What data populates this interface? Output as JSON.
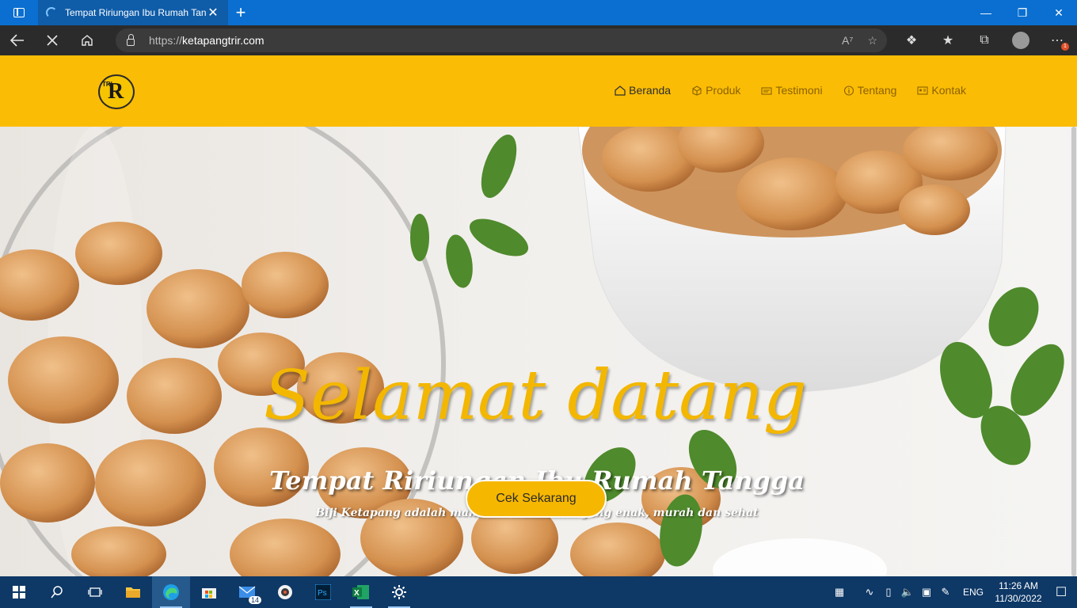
{
  "browser": {
    "tab_title": "Tempat Ririungan Ibu Rumah Tan",
    "tab_close": "✕",
    "new_tab": "+",
    "url_prefix": "https://",
    "url_domain": "ketapangtrir.com",
    "badge_count": "1"
  },
  "site": {
    "logo_text": "R",
    "logo_small": "TRI",
    "nav": [
      {
        "label": "Beranda",
        "icon": "home-icon"
      },
      {
        "label": "Produk",
        "icon": "box-icon"
      },
      {
        "label": "Testimoni",
        "icon": "card-icon"
      },
      {
        "label": "Tentang",
        "icon": "info-icon"
      },
      {
        "label": "Kontak",
        "icon": "contact-icon"
      }
    ],
    "hero": {
      "title": "Selamat datang",
      "subtitle": "Tempat Ririungan Ibu Rumah Tangga",
      "tagline": "Biji Ketapang adalah makanan tradisional yang enak, murah dan sehat",
      "cta": "Cek Sekarang"
    }
  },
  "taskbar": {
    "mail_count": "14",
    "lang": "ENG",
    "time": "11:26 AM",
    "date": "11/30/2022"
  },
  "colors": {
    "brand_yellow": "#fbbc05",
    "title_bar": "#0a6fd0",
    "taskbar": "#0e3866"
  }
}
